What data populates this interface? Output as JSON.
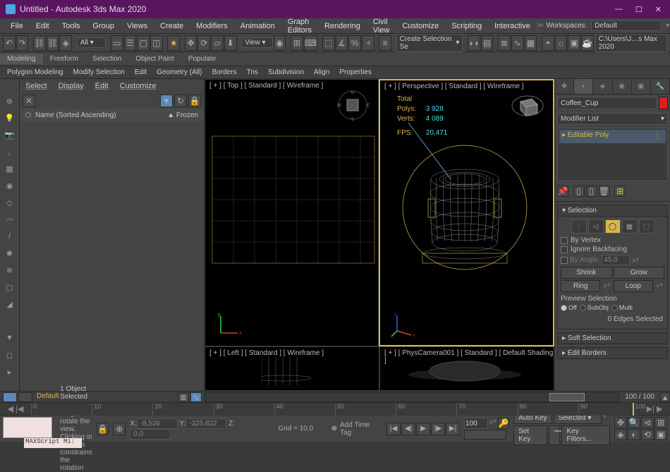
{
  "title": "Untitled - Autodesk 3ds Max 2020",
  "menu": [
    "File",
    "Edit",
    "Tools",
    "Group",
    "Views",
    "Create",
    "Modifiers",
    "Animation",
    "Graph Editors",
    "Rendering",
    "Civil View",
    "Customize",
    "Scripting",
    "Interactive"
  ],
  "workspaces": {
    "label": "Workspaces:",
    "value": "Default",
    "arrows": ">>"
  },
  "toolbar": {
    "selset": "Create Selection Se",
    "project": "C:\\Users\\J…s Max 2020"
  },
  "ribbon": {
    "tabs": [
      "Modeling",
      "Freeform",
      "Selection",
      "Object Paint",
      "Populate"
    ],
    "sub": [
      "Polygon Modeling",
      "Modify Selection",
      "Edit",
      "Geometry (All)",
      "Borders",
      "Tris",
      "Subdivision",
      "Align",
      "Properties"
    ]
  },
  "scene": {
    "menu": [
      "Select",
      "Display",
      "Edit",
      "Customize"
    ],
    "col_name": "Name (Sorted Ascending)",
    "col_frozen": "▲ Frozen"
  },
  "viewports": {
    "top": "[ + ] [ Top ] [ Standard ] [ Wireframe ]",
    "persp": "[ + ] [ Perspective ] [ Standard ] [ Wireframe ]",
    "left": "[ + ] [ Left ] [ Standard ] [ Wireframe ]",
    "cam": "[ + ] [ PhysCamera001 ] [ Standard ] [ Default Shading ]",
    "stats": {
      "total": "Total",
      "polys_l": "Polys:",
      "polys": "3 928",
      "verts_l": "Verts:",
      "verts": "4 089",
      "fps_l": "FPS:",
      "fps": "20,471"
    }
  },
  "cmdpanel": {
    "objname": "Coffee_Cup",
    "modlist": "Modifier List",
    "modstack": "Editable Poly",
    "sel": {
      "title": "Selection",
      "byvertex": "By Vertex",
      "ignore": "Ignore Backfacing",
      "byangle": "By Angle:",
      "angle": "45,0",
      "shrink": "Shrink",
      "grow": "Grow",
      "ring": "Ring",
      "loop": "Loop",
      "preview": "Preview Selection",
      "off": "Off",
      "subobj": "SubObj",
      "multi": "Multi",
      "status": "0 Edges Selected"
    },
    "softsel": "Soft Selection",
    "editb": "Edit Borders"
  },
  "timeslider": {
    "cur": "Default",
    "frame": "100 / 100"
  },
  "status": {
    "selinfo": "1 Object Selected",
    "hint": "Click and drag to rotate the view.  Clicking in the tabs constrains the rotation",
    "mscript": "MAXScript Mi:",
    "x_l": "X:",
    "x": "-8,526",
    "y_l": "Y:",
    "y": "-325,822",
    "z_l": "Z:",
    "z": "0,0",
    "grid": "Grid = 10,0",
    "addtag": "Add Time Tag",
    "autokey": "Auto Key",
    "setkey": "Set Key",
    "selected": "Selected",
    "keyfilt": "Key Filters..."
  }
}
